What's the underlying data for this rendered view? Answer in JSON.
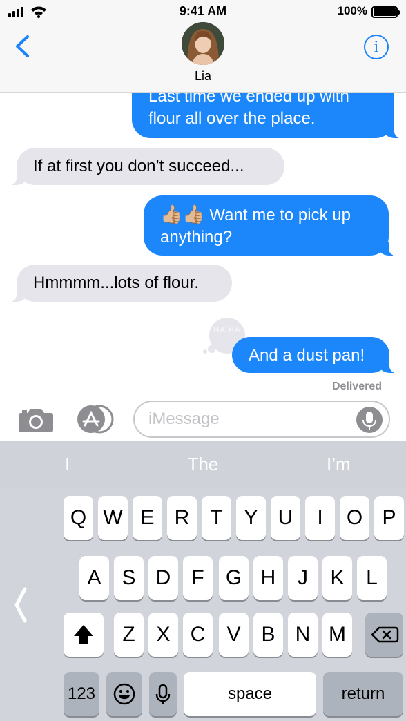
{
  "status_bar": {
    "time": "9:41 AM",
    "battery": "100%"
  },
  "header": {
    "contact_name": "Lia",
    "info_label": "i"
  },
  "messages": [
    {
      "direction": "sent",
      "line1": "Last time we ended up with",
      "line2": "flour all over the place."
    },
    {
      "direction": "received",
      "text": "If at first you don’t succeed..."
    },
    {
      "direction": "sent",
      "emoji": "👍🏼👍🏼",
      "line1": " Want me to pick up",
      "line2": "anything?"
    },
    {
      "direction": "received",
      "text": "Hmmmm...lots of flour."
    },
    {
      "direction": "sent",
      "text": "And a dust pan!",
      "reaction": "HA HA"
    }
  ],
  "status": {
    "delivered": "Delivered"
  },
  "input": {
    "placeholder": "iMessage"
  },
  "suggestions": [
    "I",
    "The",
    "I’m"
  ],
  "keyboard": {
    "row1": [
      "Q",
      "W",
      "E",
      "R",
      "T",
      "Y",
      "U",
      "I",
      "O",
      "P"
    ],
    "row2": [
      "A",
      "S",
      "D",
      "F",
      "G",
      "H",
      "J",
      "K",
      "L"
    ],
    "row3": [
      "Z",
      "X",
      "C",
      "V",
      "B",
      "N",
      "M"
    ],
    "numbers_label": "123",
    "space_label": "space",
    "return_label": "return"
  },
  "colors": {
    "accent": "#1b87fb",
    "received_bubble": "#e6e5eb",
    "keyboard_bg": "#d1d5db"
  },
  "icons": [
    "back-chevron-icon",
    "info-icon",
    "camera-icon",
    "app-store-icon",
    "microphone-icon",
    "shift-icon",
    "delete-icon",
    "emoji-icon",
    "dictation-icon"
  ]
}
